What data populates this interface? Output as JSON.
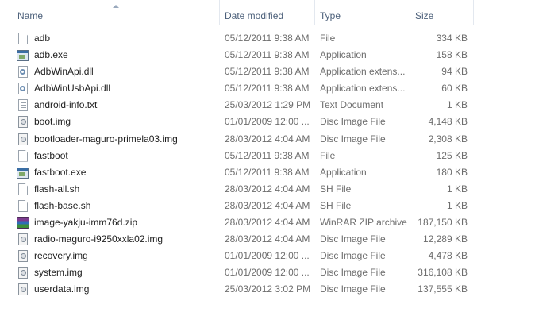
{
  "columns": {
    "name": "Name",
    "date": "Date modified",
    "type": "Type",
    "size": "Size"
  },
  "files": [
    {
      "name": "adb",
      "date": "05/12/2011 9:38 AM",
      "type": "File",
      "size": "334 KB",
      "icon": "file-icon"
    },
    {
      "name": "adb.exe",
      "date": "05/12/2011 9:38 AM",
      "type": "Application",
      "size": "158 KB",
      "icon": "exe-icon"
    },
    {
      "name": "AdbWinApi.dll",
      "date": "05/12/2011 9:38 AM",
      "type": "Application extens...",
      "size": "94 KB",
      "icon": "dll-icon"
    },
    {
      "name": "AdbWinUsbApi.dll",
      "date": "05/12/2011 9:38 AM",
      "type": "Application extens...",
      "size": "60 KB",
      "icon": "dll-icon"
    },
    {
      "name": "android-info.txt",
      "date": "25/03/2012 1:29 PM",
      "type": "Text Document",
      "size": "1 KB",
      "icon": "text-file-icon"
    },
    {
      "name": "boot.img",
      "date": "01/01/2009 12:00 ...",
      "type": "Disc Image File",
      "size": "4,148 KB",
      "icon": "disc-image-icon"
    },
    {
      "name": "bootloader-maguro-primela03.img",
      "date": "28/03/2012 4:04 AM",
      "type": "Disc Image File",
      "size": "2,308 KB",
      "icon": "disc-image-icon"
    },
    {
      "name": "fastboot",
      "date": "05/12/2011 9:38 AM",
      "type": "File",
      "size": "125 KB",
      "icon": "file-icon"
    },
    {
      "name": "fastboot.exe",
      "date": "05/12/2011 9:38 AM",
      "type": "Application",
      "size": "180 KB",
      "icon": "exe-icon"
    },
    {
      "name": "flash-all.sh",
      "date": "28/03/2012 4:04 AM",
      "type": "SH File",
      "size": "1 KB",
      "icon": "file-icon"
    },
    {
      "name": "flash-base.sh",
      "date": "28/03/2012 4:04 AM",
      "type": "SH File",
      "size": "1 KB",
      "icon": "file-icon"
    },
    {
      "name": "image-yakju-imm76d.zip",
      "date": "28/03/2012 4:04 AM",
      "type": "WinRAR ZIP archive",
      "size": "187,150 KB",
      "icon": "zip-archive-icon"
    },
    {
      "name": "radio-maguro-i9250xxla02.img",
      "date": "28/03/2012 4:04 AM",
      "type": "Disc Image File",
      "size": "12,289 KB",
      "icon": "disc-image-icon"
    },
    {
      "name": "recovery.img",
      "date": "01/01/2009 12:00 ...",
      "type": "Disc Image File",
      "size": "4,478 KB",
      "icon": "disc-image-icon"
    },
    {
      "name": "system.img",
      "date": "01/01/2009 12:00 ...",
      "type": "Disc Image File",
      "size": "316,108 KB",
      "icon": "disc-image-icon"
    },
    {
      "name": "userdata.img",
      "date": "25/03/2012 3:02 PM",
      "type": "Disc Image File",
      "size": "137,555 KB",
      "icon": "disc-image-icon"
    }
  ]
}
